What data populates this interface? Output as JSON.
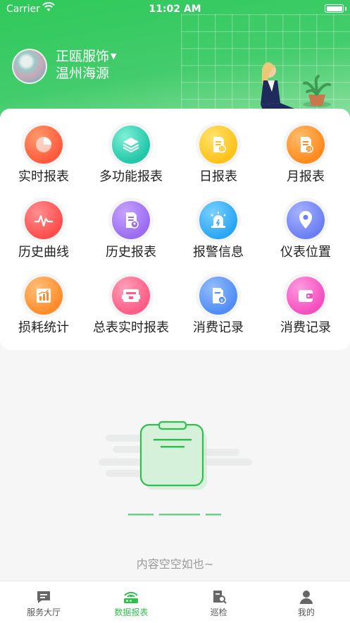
{
  "status_bar": {
    "carrier": "Carrier",
    "time": "11:02 AM"
  },
  "header": {
    "company": "正瓯服饰",
    "location": "温州海源"
  },
  "menu": [
    {
      "label": "实时报表",
      "icon": "pie-chart-icon",
      "color": "#ff5a3c"
    },
    {
      "label": "多功能报表",
      "icon": "layers-icon",
      "color": "#21c7a8"
    },
    {
      "label": "日报表",
      "icon": "daily-report-icon",
      "color": "#ffc21a"
    },
    {
      "label": "月报表",
      "icon": "monthly-report-icon",
      "color": "#ff8a1e"
    },
    {
      "label": "历史曲线",
      "icon": "history-curve-icon",
      "color": "#ff4d4d"
    },
    {
      "label": "历史报表",
      "icon": "history-report-icon",
      "color": "#9b6cf0"
    },
    {
      "label": "报警信息",
      "icon": "alarm-light-icon",
      "color": "#2aa6f5"
    },
    {
      "label": "仪表位置",
      "icon": "location-pin-icon",
      "color": "#6b7ff2"
    },
    {
      "label": "损耗统计",
      "icon": "loss-chart-icon",
      "color": "#ff8c2a"
    },
    {
      "label": "总表实时报表",
      "icon": "meter-icon",
      "color": "#ff5c86"
    },
    {
      "label": "消费记录",
      "icon": "yuan-document-icon",
      "color": "#4f8df5"
    },
    {
      "label": "消费记录",
      "icon": "wallet-icon",
      "color": "#f44fbf"
    }
  ],
  "empty_state": {
    "text": "内容空空如也~"
  },
  "tabbar": [
    {
      "label": "服务大厅",
      "icon": "service-hall-icon",
      "active": false
    },
    {
      "label": "数据报表",
      "icon": "data-report-icon",
      "active": true
    },
    {
      "label": "巡检",
      "icon": "inspection-icon",
      "active": false
    },
    {
      "label": "我的",
      "icon": "profile-icon",
      "active": false
    }
  ]
}
